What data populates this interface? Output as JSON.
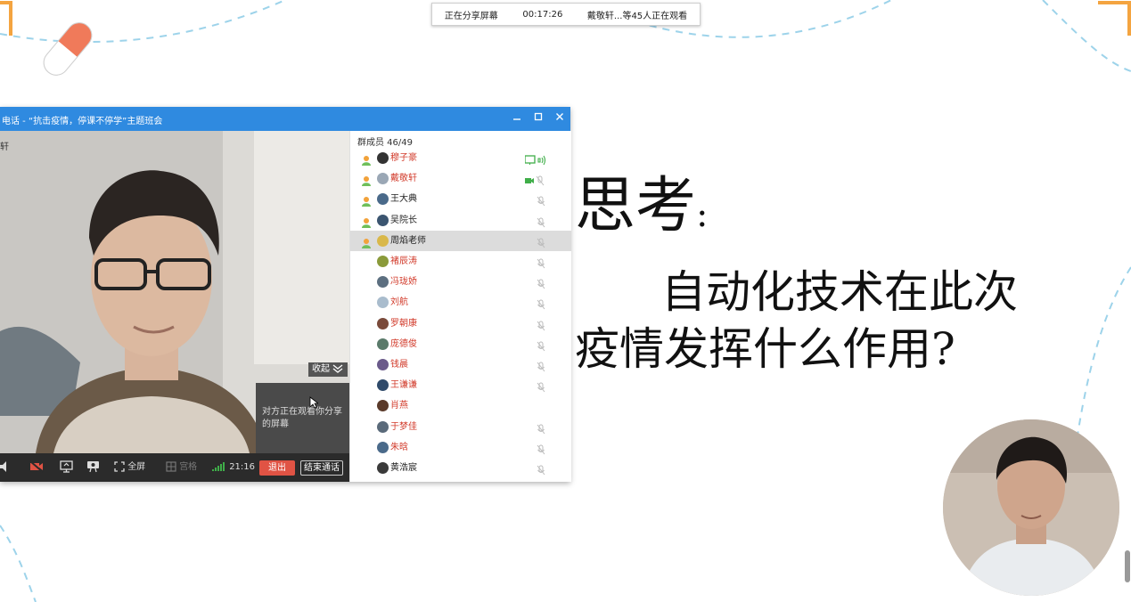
{
  "share_banner": {
    "status": "正在分享屏幕",
    "timer": "00:17:26",
    "viewers": "戴敬轩...等45人正在观看"
  },
  "call_window": {
    "title": "电话 - “抗击疫情，停课不停学”主题班会",
    "video_label": "轩",
    "collapse_label": "收起",
    "share_note": "对方正在观看你分享的屏幕",
    "toolbar": {
      "fullscreen": "全屏",
      "grid": "宫格",
      "duration": "21:16",
      "exit": "退出",
      "end_call": "结束通话"
    },
    "members": {
      "header": "群成员 46/49",
      "list": [
        {
          "name": "穆子豪",
          "color": "#d23b2b",
          "host": true,
          "avatar": "#333333",
          "mic": "speaking"
        },
        {
          "name": "戴敬轩",
          "color": "#d23b2b",
          "host": true,
          "avatar": "#9aa7b5",
          "mic": "camera"
        },
        {
          "name": "王大典",
          "color": "#222222",
          "host": true,
          "avatar": "#4a6a8a",
          "mic": "muted"
        },
        {
          "name": "吴院长",
          "color": "#222222",
          "host": true,
          "avatar": "#3b5570",
          "mic": "muted"
        },
        {
          "name": "周焰老师",
          "color": "#222222",
          "host": true,
          "avatar": "#d9b84a",
          "mic": "muted",
          "selected": true
        },
        {
          "name": "褚辰涛",
          "color": "#d23b2b",
          "host": false,
          "avatar": "#8a9a3a",
          "mic": "muted"
        },
        {
          "name": "冯珑娇",
          "color": "#d23b2b",
          "host": false,
          "avatar": "#5c6f80",
          "mic": "muted"
        },
        {
          "name": "刘航",
          "color": "#d23b2b",
          "host": false,
          "avatar": "#a9bccd",
          "mic": "muted"
        },
        {
          "name": "罗朝康",
          "color": "#d23b2b",
          "host": false,
          "avatar": "#7a4a3a",
          "mic": "muted"
        },
        {
          "name": "庞德俊",
          "color": "#d23b2b",
          "host": false,
          "avatar": "#5a7a6a",
          "mic": "muted"
        },
        {
          "name": "钱晨",
          "color": "#d23b2b",
          "host": false,
          "avatar": "#6a5a8a",
          "mic": "muted"
        },
        {
          "name": "王谦谦",
          "color": "#d23b2b",
          "host": false,
          "avatar": "#2f4a6a",
          "mic": "muted"
        },
        {
          "name": "肖燕",
          "color": "#d23b2b",
          "host": false,
          "avatar": "#5a3a2a",
          "mic": "none"
        },
        {
          "name": "于梦佳",
          "color": "#d23b2b",
          "host": false,
          "avatar": "#5a6a7a",
          "mic": "muted"
        },
        {
          "name": "朱晗",
          "color": "#d23b2b",
          "host": false,
          "avatar": "#4a6a8a",
          "mic": "muted"
        },
        {
          "name": "黄浩宸",
          "color": "#222222",
          "host": false,
          "avatar": "#3a3a3a",
          "mic": "muted"
        }
      ]
    }
  },
  "slide": {
    "heading": "思考",
    "heading_colon": ":",
    "question_line1": "自动化技术在此次",
    "question_line2": "疫情发挥什么作用?"
  }
}
